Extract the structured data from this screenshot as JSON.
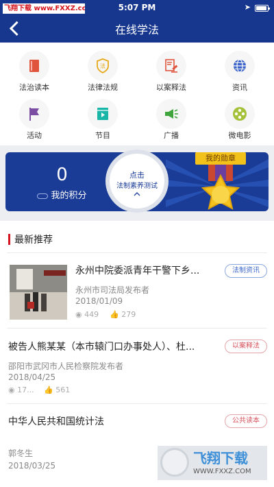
{
  "status": {
    "watermark": "飞翔下载 www.FXXZ.com",
    "time": "5:07 PM"
  },
  "header": {
    "title": "在线学法"
  },
  "categories": [
    {
      "label": "法治读本",
      "icon": "book-icon",
      "color": "#e0533d"
    },
    {
      "label": "法律法规",
      "icon": "shield-law-icon",
      "color": "#e6a817"
    },
    {
      "label": "以案释法",
      "icon": "gavel-doc-icon",
      "color": "#e0533d"
    },
    {
      "label": "资讯",
      "icon": "globe-icon",
      "color": "#3c63c8"
    },
    {
      "label": "活动",
      "icon": "flag-icon",
      "color": "#7b4ea3"
    },
    {
      "label": "节目",
      "icon": "play-screen-icon",
      "color": "#19b6a8"
    },
    {
      "label": "广播",
      "icon": "megaphone-icon",
      "color": "#3fa43c"
    },
    {
      "label": "微电影",
      "icon": "film-reel-icon",
      "color": "#a5c13a"
    }
  ],
  "score": {
    "value": "0",
    "label": "我的积分",
    "test_line1": "点击",
    "test_line2": "法制素养测试",
    "medal_label": "我的勋章"
  },
  "section": {
    "title": "最新推荐"
  },
  "news": [
    {
      "title": "永州中院委派青年干警下乡...",
      "publisher": "永州市司法局发布者",
      "date": "2018/01/09",
      "views": "449",
      "likes": "279",
      "tag": "法制资讯"
    },
    {
      "title": "被告人熊某某（本市辕门口办事处人）、杜...",
      "publisher": "邵阳市武冈市人民检察院发布者",
      "date": "2018/04/25",
      "views": "17...",
      "likes": "561",
      "tag": "以案释法"
    },
    {
      "title": "中华人民共和国统计法",
      "publisher": "郭冬生",
      "date": "2018/03/25",
      "tag": "公共读本"
    }
  ],
  "watermark_bottom": {
    "brand": "飞翔下载",
    "url": "WWW.FXXZ.COM"
  },
  "colors": {
    "header": "#17378f",
    "banner": "#1a3c96",
    "accent_red": "#d4141f",
    "medal_gold": "#f3c21a"
  }
}
